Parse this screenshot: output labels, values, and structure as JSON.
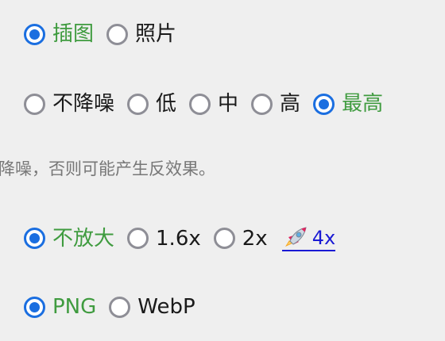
{
  "image_type": {
    "options": [
      {
        "label": "插图",
        "checked": true
      },
      {
        "label": "照片",
        "checked": false
      }
    ]
  },
  "denoise": {
    "options": [
      {
        "label": "不降噪",
        "checked": false
      },
      {
        "label": "低",
        "checked": false
      },
      {
        "label": "中",
        "checked": false
      },
      {
        "label": "高",
        "checked": false
      },
      {
        "label": "最高",
        "checked": true
      }
    ],
    "hint": "降噪，否则可能产生反效果。"
  },
  "upscale": {
    "options": [
      {
        "label": "不放大",
        "checked": true
      },
      {
        "label": "1.6x",
        "checked": false
      },
      {
        "label": "2x",
        "checked": false
      }
    ],
    "link": {
      "label": "4x",
      "icon": "rocket-icon"
    }
  },
  "format": {
    "options": [
      {
        "label": "PNG",
        "checked": true
      },
      {
        "label": "WebP",
        "checked": false
      }
    ]
  },
  "colors": {
    "radio_checked": "#1a6ee0",
    "radio_unchecked": "#8e8e96",
    "selected_label": "#3f9b3f",
    "link": "#1a1ad4"
  }
}
